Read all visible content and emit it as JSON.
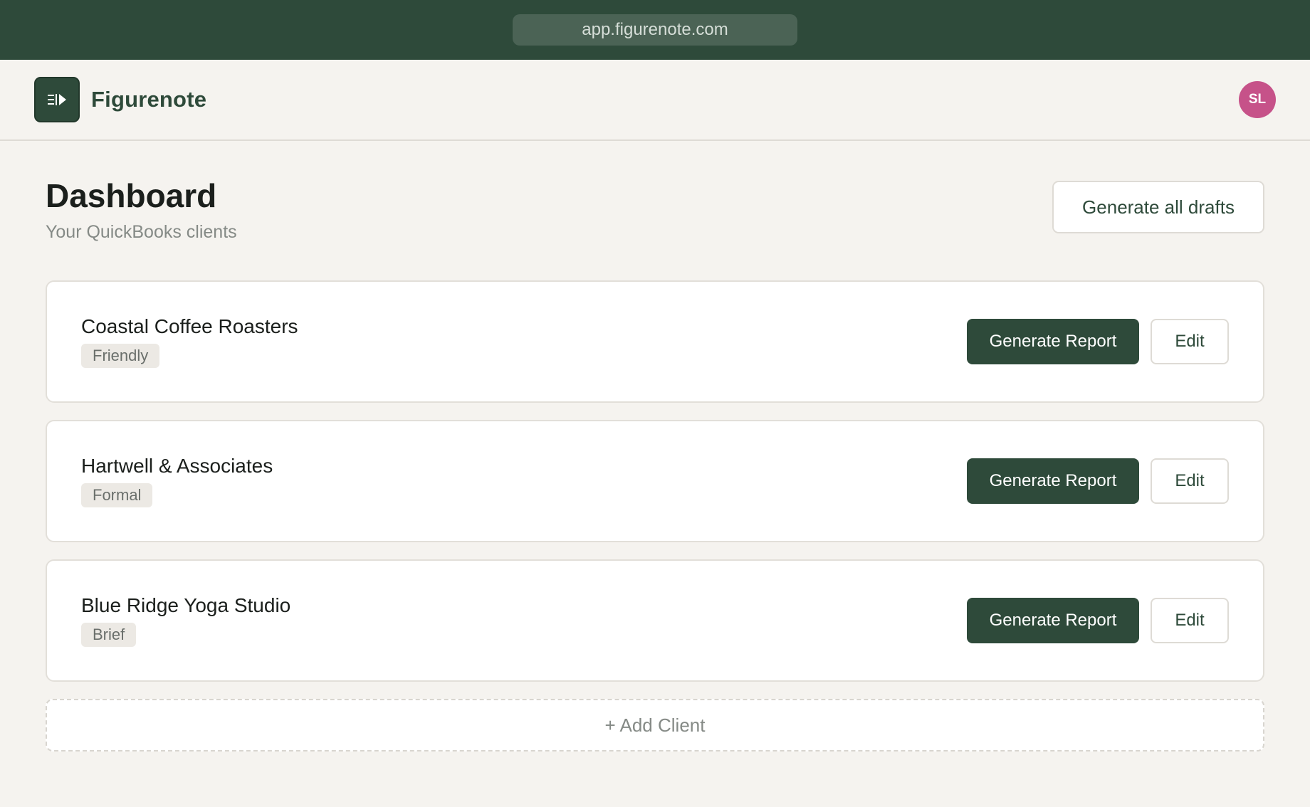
{
  "browser": {
    "url": "app.figurenote.com"
  },
  "header": {
    "brand": "Figurenote",
    "avatar_initials": "SL",
    "avatar_color": "#c65289"
  },
  "page": {
    "title": "Dashboard",
    "subtitle": "Your QuickBooks clients",
    "generate_all_label": "Generate all drafts"
  },
  "clients": [
    {
      "name": "Coastal Coffee Roasters",
      "tone": "Friendly",
      "generate_label": "Generate Report",
      "edit_label": "Edit"
    },
    {
      "name": "Hartwell & Associates",
      "tone": "Formal",
      "generate_label": "Generate Report",
      "edit_label": "Edit"
    },
    {
      "name": "Blue Ridge Yoga Studio",
      "tone": "Brief",
      "generate_label": "Generate Report",
      "edit_label": "Edit"
    }
  ],
  "add_client_label": "+ Add Client",
  "colors": {
    "brand": "#2e4a3a",
    "background": "#f5f3ef"
  },
  "icons": {
    "logo": "play-list-icon"
  }
}
